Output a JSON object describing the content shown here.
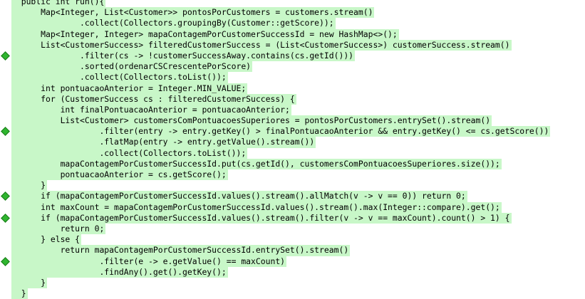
{
  "editor": {
    "highlight_color": "#c8f7c8",
    "change_marker_color": "#2fb52f",
    "lines": [
      {
        "text": "  public int run(){",
        "marker": false
      },
      {
        "text": "      Map<Integer, List<Customer>> pontosPorCustomers = customers.stream()",
        "marker": false
      },
      {
        "text": "              .collect(Collectors.groupingBy(Customer::getScore));",
        "marker": false
      },
      {
        "text": "      Map<Integer, Integer> mapaContagemPorCustomerSuccessId = new HashMap<>();",
        "marker": false
      },
      {
        "text": "      List<CustomerSuccess> filteredCustomerSuccess = (List<CustomerSuccess>) customerSuccess.stream()",
        "marker": false
      },
      {
        "text": "              .filter(cs -> !customerSuccessAway.contains(cs.getId()))",
        "marker": true
      },
      {
        "text": "              .sorted(ordenarCSCrescentePorScore)",
        "marker": false
      },
      {
        "text": "              .collect(Collectors.toList());",
        "marker": false
      },
      {
        "text": "      int pontuacaoAnterior = Integer.MIN_VALUE;",
        "marker": false
      },
      {
        "text": "      for (CustomerSuccess cs : filteredCustomerSuccess) {",
        "marker": false
      },
      {
        "text": "          int finalPontuacaoAnterior = pontuacaoAnterior;",
        "marker": false
      },
      {
        "text": "          List<Customer> customersComPontuacoesSuperiores = pontosPorCustomers.entrySet().stream()",
        "marker": false
      },
      {
        "text": "                  .filter(entry -> entry.getKey() > finalPontuacaoAnterior && entry.getKey() <= cs.getScore())",
        "marker": true
      },
      {
        "text": "                  .flatMap(entry -> entry.getValue().stream())",
        "marker": false
      },
      {
        "text": "                  .collect(Collectors.toList());",
        "marker": false
      },
      {
        "text": "          mapaContagemPorCustomerSuccessId.put(cs.getId(), customersComPontuacoesSuperiores.size());",
        "marker": false
      },
      {
        "text": "          pontuacaoAnterior = cs.getScore();",
        "marker": false
      },
      {
        "text": "      }",
        "marker": false
      },
      {
        "text": "      if (mapaContagemPorCustomerSuccessId.values().stream().allMatch(v -> v == 0)) return 0;",
        "marker": true
      },
      {
        "text": "      int maxCount = mapaContagemPorCustomerSuccessId.values().stream().max(Integer::compare).get();",
        "marker": false
      },
      {
        "text": "      if (mapaContagemPorCustomerSuccessId.values().stream().filter(v -> v == maxCount).count() > 1) {",
        "marker": true
      },
      {
        "text": "          return 0;",
        "marker": false
      },
      {
        "text": "      } else {",
        "marker": false
      },
      {
        "text": "          return mapaContagemPorCustomerSuccessId.entrySet().stream()",
        "marker": false
      },
      {
        "text": "                  .filter(e -> e.getValue() == maxCount)",
        "marker": true
      },
      {
        "text": "                  .findAny().get().getKey();",
        "marker": false
      },
      {
        "text": "      }",
        "marker": false
      },
      {
        "text": "  }",
        "marker": false
      }
    ]
  }
}
